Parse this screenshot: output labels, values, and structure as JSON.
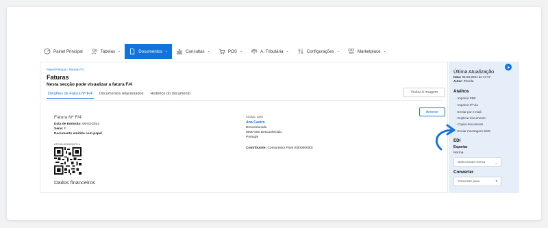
{
  "nav": {
    "items": [
      {
        "label": "Painel Principal",
        "icon": "dashboard-icon",
        "has_dropdown": false
      },
      {
        "label": "Tabelas",
        "icon": "users-icon",
        "has_dropdown": true
      },
      {
        "label": "Documentos",
        "icon": "document-icon",
        "has_dropdown": true,
        "active": true
      },
      {
        "label": "Consultas",
        "icon": "bar-chart-icon",
        "has_dropdown": true
      },
      {
        "label": "POS",
        "icon": "cart-icon",
        "has_dropdown": true
      },
      {
        "label": "A. Tributária",
        "icon": "balance-icon",
        "has_dropdown": true
      },
      {
        "label": "Configurações",
        "icon": "settings-sliders-icon",
        "has_dropdown": true
      },
      {
        "label": "Marketplace",
        "icon": "grid-icon",
        "has_dropdown": true
      }
    ]
  },
  "breadcrumb": "Painel Principal · Faturas F/4",
  "page": {
    "title": "Faturas",
    "subtitle": "Nesta secção pode visualizar a fatura F/4"
  },
  "tabs": [
    "Detalhes da Fatura Nº F/4",
    "Documentos relacionados",
    "Histórico do documento"
  ],
  "buttons": {
    "view_image": "Visitar A Imagem",
    "previous": "Anterior"
  },
  "invoice": {
    "title": "Fatura Nº F/4",
    "issue_label": "Data de Emissão:",
    "issue_date": "06-03-2024",
    "series_label": "Série:",
    "series_value": "F",
    "paper_note": "Documento emitido com papel",
    "qr_code_text": "ATCUD:XEHDGATC-4",
    "financial_section": "Dados financeiros"
  },
  "client": {
    "code_label": "Código: 1260",
    "name": "Ana Castro",
    "line1": "Desconhecido",
    "line2": "0000-000 Desconhecido",
    "country": "Portugal",
    "taxpayer_label": "Contribuinte:",
    "taxpayer_value": "Consumidor Final (000000000)"
  },
  "side": {
    "title": "Última Atualização",
    "date_label": "Data:",
    "date_value": "06-03-2024 às 17:17",
    "author_label": "Autor:",
    "author_value": "Priscila",
    "shortcuts_heading": "Atalhos",
    "shortcuts": [
      "- Imprimir PDF",
      "- Imprimir 2ª Via",
      "- Enviar por e-mail",
      "- Duplicar documento",
      "- Copiar documento",
      "- Enviar mensagem SMS"
    ],
    "edi_heading": "EDI",
    "export_label": "Exportar",
    "norm_label": "Norma",
    "norm_select": "Seleccionar norma",
    "convert_heading": "Converter",
    "convert_select": "Converter para"
  },
  "colors": {
    "accent": "#1273de",
    "side_panel": "#e6eefa"
  }
}
